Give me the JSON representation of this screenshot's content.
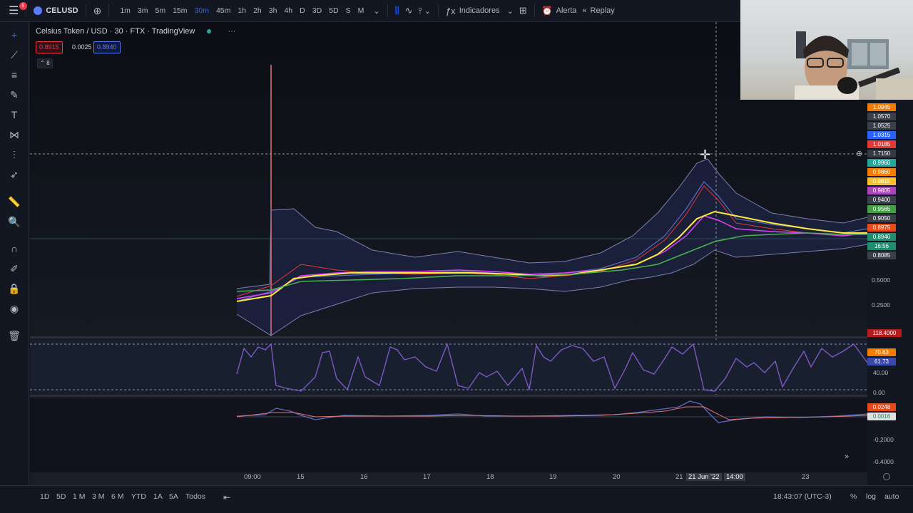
{
  "topbar": {
    "badge": "8",
    "symbol": "CELUSD",
    "intervals": [
      "1m",
      "3m",
      "5m",
      "15m",
      "30m",
      "45m",
      "1h",
      "2h",
      "3h",
      "4h",
      "D",
      "3D",
      "5D",
      "S",
      "M"
    ],
    "active_interval": "30m",
    "indicators_label": "Indicadores",
    "alert_label": "Alerta",
    "replay_label": "Replay"
  },
  "legend": {
    "title": "Celsius Token / USD · 30 · FTX · TradingView",
    "bid": "0.8915",
    "spread": "0.0025",
    "ask": "0.8940",
    "collapsed_count": "8"
  },
  "price_labels": [
    {
      "text": "1.0945",
      "color": "#f57c00"
    },
    {
      "text": "1.0570",
      "color": "#3b3f4a"
    },
    {
      "text": "1.0525",
      "color": "#3b3f4a"
    },
    {
      "text": "1.0315",
      "color": "#2962ff"
    },
    {
      "text": "1.0185",
      "color": "#e53935"
    },
    {
      "text": "1.7150",
      "color": "#363a45"
    },
    {
      "text": "0.9960",
      "color": "#26a69a"
    },
    {
      "text": "0.9860",
      "color": "#f57c00"
    },
    {
      "text": "0.9815",
      "color": "#fbc02d"
    },
    {
      "text": "0.9805",
      "color": "#ab47bc"
    },
    {
      "text": "0.9400",
      "color": "#3b3f4a"
    },
    {
      "text": "0.9565",
      "color": "#43a047"
    },
    {
      "text": "0.9050",
      "color": "#3b3f4a"
    },
    {
      "text": "0.8975",
      "color": "#e64a19"
    },
    {
      "text": "0.8940",
      "color": "#1e8e6e"
    },
    {
      "text": "16:56",
      "color": "#1e8e6e"
    },
    {
      "text": "0.8085",
      "color": "#3b3f4a"
    }
  ],
  "price_axis": [
    "0.5000",
    "0.2500"
  ],
  "rsi": {
    "label_top": "118.4000",
    "value1": "70.63",
    "value2": "61.73",
    "level": "40.00",
    "bottom": "0.00"
  },
  "macd": {
    "v1": "0.0248",
    "v2": "0.0016",
    "ticks": [
      "-0.2000",
      "-0.4000"
    ]
  },
  "x_axis": [
    "09:00",
    "15",
    "16",
    "17",
    "18",
    "19",
    "20",
    "21",
    "21 Jun '22",
    "14:00",
    "23"
  ],
  "bottom": {
    "ranges": [
      "1D",
      "5D",
      "1 M",
      "3 M",
      "6 M",
      "YTD",
      "1A",
      "5A",
      "Todos"
    ],
    "time": "18:43:07 (UTC-3)",
    "percent": "%",
    "log": "log",
    "auto": "auto"
  },
  "colors": {
    "ema_yellow": "#ffeb3b",
    "ema_green": "#4caf50",
    "band_purple": "#5c6bc0",
    "rsi_line": "#7e57c2"
  }
}
